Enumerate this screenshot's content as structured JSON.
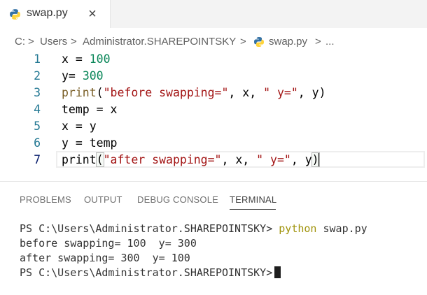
{
  "tab": {
    "label": "swap.py",
    "close_glyph": "×",
    "icon": "python-file-icon"
  },
  "breadcrumb": {
    "items": [
      "C:",
      "Users",
      "Administrator.SHAREPOINTSKY",
      "swap.py",
      "..."
    ],
    "separator": ">"
  },
  "editor": {
    "lines": [
      {
        "number": "1",
        "text": "x = 100"
      },
      {
        "number": "2",
        "text": "y= 300"
      },
      {
        "number": "3",
        "text": "print(\"before swapping=\", x, \" y=\", y)"
      },
      {
        "number": "4",
        "text": "temp = x"
      },
      {
        "number": "5",
        "text": "x = y"
      },
      {
        "number": "6",
        "text": "y = temp"
      },
      {
        "number": "7",
        "text": "print(\"after swapping=\", x, \" y=\", y)"
      }
    ],
    "current_line": "7"
  },
  "panel": {
    "tabs": [
      "PROBLEMS",
      "OUTPUT",
      "DEBUG CONSOLE",
      "TERMINAL"
    ],
    "active_tab": "TERMINAL"
  },
  "terminal": {
    "prompt": "PS C:\\Users\\Administrator.SHAREPOINTSKY>",
    "command_name": "python",
    "command_arg": "swap.py",
    "output": [
      "before swapping= 100  y= 300",
      "after swapping= 300  y= 100"
    ]
  },
  "colors": {
    "line_number": "#237893",
    "number_literal": "#098658",
    "string_literal": "#a31515",
    "function_name": "#795e26",
    "terminal_command": "#a0930b",
    "python_blue": "#3572a5",
    "python_yellow": "#ffd43b"
  }
}
